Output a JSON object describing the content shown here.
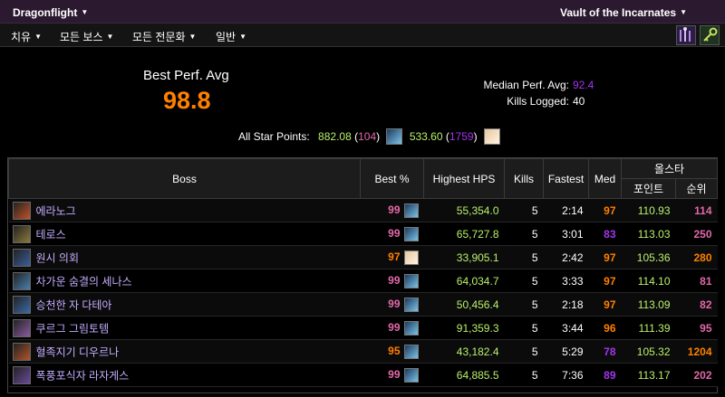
{
  "topbar": {
    "expansion": "Dragonflight",
    "zone": "Vault of the Incarnates"
  },
  "menu": {
    "items": [
      "치유",
      "모든 보스",
      "모든 전문화",
      "일반"
    ],
    "icons": [
      "class-spec-icon",
      "link-icon"
    ]
  },
  "summary": {
    "best_perf_label": "Best Perf. Avg",
    "best_perf_value": "98.8",
    "median_label": "Median Perf. Avg:",
    "median_value": "92.4",
    "kills_label": "Kills Logged:",
    "kills_value": "40",
    "star_label": "All Star Points:",
    "star1_points": "882.08",
    "star1_rank": "104",
    "star2_points": "533.60",
    "star2_rank": "1759"
  },
  "table": {
    "headers": {
      "boss": "Boss",
      "best": "Best %",
      "hps": "Highest HPS",
      "kills": "Kills",
      "fastest": "Fastest",
      "med": "Med",
      "allstar": "올스타",
      "points": "포인트",
      "rank": "순위"
    },
    "rows": [
      {
        "boss": "에라노그",
        "best": "99",
        "hps": "55,354.0",
        "kills": "5",
        "fastest": "2:14",
        "med": "97",
        "points": "110.93",
        "rank": "114",
        "icon_color": "#c0522a",
        "best_color": "#e268a8",
        "med_color": "#ff8000",
        "rank_color": "#e268a8"
      },
      {
        "boss": "테로스",
        "best": "99",
        "hps": "65,727.8",
        "kills": "5",
        "fastest": "3:01",
        "med": "83",
        "points": "113.03",
        "rank": "250",
        "icon_color": "#8a7a3a",
        "best_color": "#e268a8",
        "med_color": "#a335ee",
        "rank_color": "#e268a8"
      },
      {
        "boss": "원시 의회",
        "best": "97",
        "hps": "33,905.1",
        "kills": "5",
        "fastest": "2:42",
        "med": "97",
        "points": "105.36",
        "rank": "280",
        "icon_color": "#3a5e9a",
        "best_color": "#ff8000",
        "med_color": "#ff8000",
        "rank_color": "#ff8000"
      },
      {
        "boss": "차가운 숨결의 세나스",
        "best": "99",
        "hps": "64,034.7",
        "kills": "5",
        "fastest": "3:33",
        "med": "97",
        "points": "114.10",
        "rank": "81",
        "icon_color": "#4a7fae",
        "best_color": "#e268a8",
        "med_color": "#ff8000",
        "rank_color": "#e268a8"
      },
      {
        "boss": "승천한 자 다테아",
        "best": "99",
        "hps": "50,456.4",
        "kills": "5",
        "fastest": "2:18",
        "med": "97",
        "points": "113.09",
        "rank": "82",
        "icon_color": "#3b6aa8",
        "best_color": "#e268a8",
        "med_color": "#ff8000",
        "rank_color": "#e268a8"
      },
      {
        "boss": "쿠르그 그림토템",
        "best": "99",
        "hps": "91,359.3",
        "kills": "5",
        "fastest": "3:44",
        "med": "96",
        "points": "111.39",
        "rank": "95",
        "icon_color": "#8a5aa0",
        "best_color": "#e268a8",
        "med_color": "#ff8000",
        "rank_color": "#e268a8"
      },
      {
        "boss": "혈족지기 디우르나",
        "best": "95",
        "hps": "43,182.4",
        "kills": "5",
        "fastest": "5:29",
        "med": "78",
        "points": "105.32",
        "rank": "1204",
        "icon_color": "#b0552a",
        "best_color": "#ff8000",
        "med_color": "#a335ee",
        "rank_color": "#ff8000"
      },
      {
        "boss": "폭풍포식자 라자게스",
        "best": "99",
        "hps": "64,885.5",
        "kills": "5",
        "fastest": "7:36",
        "med": "89",
        "points": "113.17",
        "rank": "202",
        "icon_color": "#6a4a9a",
        "best_color": "#e268a8",
        "med_color": "#a335ee",
        "rank_color": "#e268a8"
      }
    ],
    "row_spec_icons": [
      "water-spec-icon",
      "water-spec-icon",
      "holy-spec-icon",
      "water-spec-icon",
      "water-spec-icon",
      "water-spec-icon",
      "water-spec-icon",
      "water-spec-icon"
    ]
  }
}
